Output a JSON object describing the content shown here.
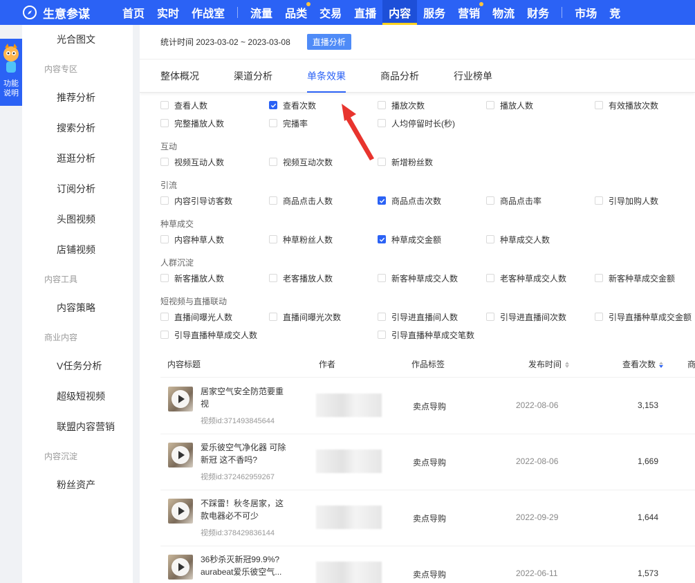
{
  "brand": {
    "title": "生意参谋"
  },
  "nav": {
    "items": [
      {
        "label": "首页",
        "active": false,
        "dot": false
      },
      {
        "label": "实时",
        "active": false,
        "dot": false
      },
      {
        "label": "作战室",
        "active": false,
        "dot": false
      },
      {
        "label": "流量",
        "active": false,
        "dot": false
      },
      {
        "label": "品类",
        "active": false,
        "dot": true
      },
      {
        "label": "交易",
        "active": false,
        "dot": false
      },
      {
        "label": "直播",
        "active": false,
        "dot": false
      },
      {
        "label": "内容",
        "active": true,
        "dot": false
      },
      {
        "label": "服务",
        "active": false,
        "dot": false
      },
      {
        "label": "营销",
        "active": false,
        "dot": true
      },
      {
        "label": "物流",
        "active": false,
        "dot": false
      },
      {
        "label": "财务",
        "active": false,
        "dot": false
      },
      {
        "label": "市场",
        "active": false,
        "dot": false
      },
      {
        "label": "竞",
        "active": false,
        "dot": false
      }
    ]
  },
  "helper": {
    "label_line1": "功能",
    "label_line2": "说明"
  },
  "sidebar": {
    "top_item": "光合图文",
    "group1": "内容专区",
    "items1": [
      "推荐分析",
      "搜索分析",
      "逛逛分析",
      "订阅分析",
      "头图视频",
      "店铺视频"
    ],
    "group2": "内容工具",
    "items2": [
      "内容策略"
    ],
    "group3": "商业内容",
    "items3": [
      "V任务分析",
      "超级短视频",
      "联盟内容营销"
    ],
    "group4": "内容沉淀",
    "items4": [
      "粉丝资产"
    ]
  },
  "stat": {
    "text": "统计时间 2023-03-02 ~ 2023-03-08",
    "badge": "直播分析"
  },
  "tabs": [
    "整体概况",
    "渠道分析",
    "单条效果",
    "商品分析",
    "行业榜单"
  ],
  "active_tab": "单条效果",
  "metrics": {
    "basic": [
      {
        "label": "查看人数",
        "checked": false
      },
      {
        "label": "查看次数",
        "checked": true
      },
      {
        "label": "播放次数",
        "checked": false
      },
      {
        "label": "播放人数",
        "checked": false
      },
      {
        "label": "有效播放次数",
        "checked": false
      },
      {
        "label": "完整播放人数",
        "checked": false
      },
      {
        "label": "完播率",
        "checked": false
      },
      {
        "label": "人均停留时长(秒)",
        "checked": false
      }
    ],
    "group_interact": "互动",
    "interact": [
      {
        "label": "视频互动人数",
        "checked": false
      },
      {
        "label": "视频互动次数",
        "checked": false
      },
      {
        "label": "新增粉丝数",
        "checked": false
      }
    ],
    "group_traffic": "引流",
    "traffic": [
      {
        "label": "内容引导访客数",
        "checked": false
      },
      {
        "label": "商品点击人数",
        "checked": false
      },
      {
        "label": "商品点击次数",
        "checked": true
      },
      {
        "label": "商品点击率",
        "checked": false
      },
      {
        "label": "引导加购人数",
        "checked": false
      }
    ],
    "group_seed": "种草成交",
    "seed": [
      {
        "label": "内容种草人数",
        "checked": false
      },
      {
        "label": "种草粉丝人数",
        "checked": false
      },
      {
        "label": "种草成交金额",
        "checked": true
      },
      {
        "label": "种草成交人数",
        "checked": false
      }
    ],
    "group_crowd": "人群沉淀",
    "crowd": [
      {
        "label": "新客播放人数",
        "checked": false
      },
      {
        "label": "老客播放人数",
        "checked": false
      },
      {
        "label": "新客种草成交人数",
        "checked": false
      },
      {
        "label": "老客种草成交人数",
        "checked": false
      },
      {
        "label": "新客种草成交金额",
        "checked": false
      }
    ],
    "group_live": "短视频与直播联动",
    "live": [
      {
        "label": "直播间曝光人数",
        "checked": false
      },
      {
        "label": "直播间曝光次数",
        "checked": false
      },
      {
        "label": "引导进直播间人数",
        "checked": false
      },
      {
        "label": "引导进直播间次数",
        "checked": false
      },
      {
        "label": "引导直播种草成交金额",
        "checked": false
      },
      {
        "label": "引导直播种草成交人数",
        "checked": false
      },
      {
        "label": "引导直播种草成交笔数",
        "checked": false
      }
    ]
  },
  "table": {
    "headers": {
      "title": "内容标题",
      "author": "作者",
      "tag": "作品标签",
      "date": "发布时间",
      "views": "查看次数",
      "extra": "商"
    },
    "rows": [
      {
        "title": "居家空气安全防范要重视",
        "vid": "视频id:371493845644",
        "tag": "卖点导购",
        "date": "2022-08-06",
        "views": "3,153"
      },
      {
        "title": "爱乐彼空气净化器 可除新冠 这不香吗?",
        "vid": "视频id:372462959267",
        "tag": "卖点导购",
        "date": "2022-08-06",
        "views": "1,669"
      },
      {
        "title": "不踩雷！秋冬居家，这款电器必不可少",
        "vid": "视频id:378429836144",
        "tag": "卖点导购",
        "date": "2022-09-29",
        "views": "1,644"
      },
      {
        "title": "36秒杀灭新冠99.9%? aurabeat爱乐彼空气...",
        "vid": "",
        "tag": "卖点导购",
        "date": "2022-06-11",
        "views": "1,573"
      }
    ]
  },
  "colors": {
    "primary": "#2b62f5",
    "active_nav": "#1d4fd8",
    "arrow": "#e8342e"
  }
}
